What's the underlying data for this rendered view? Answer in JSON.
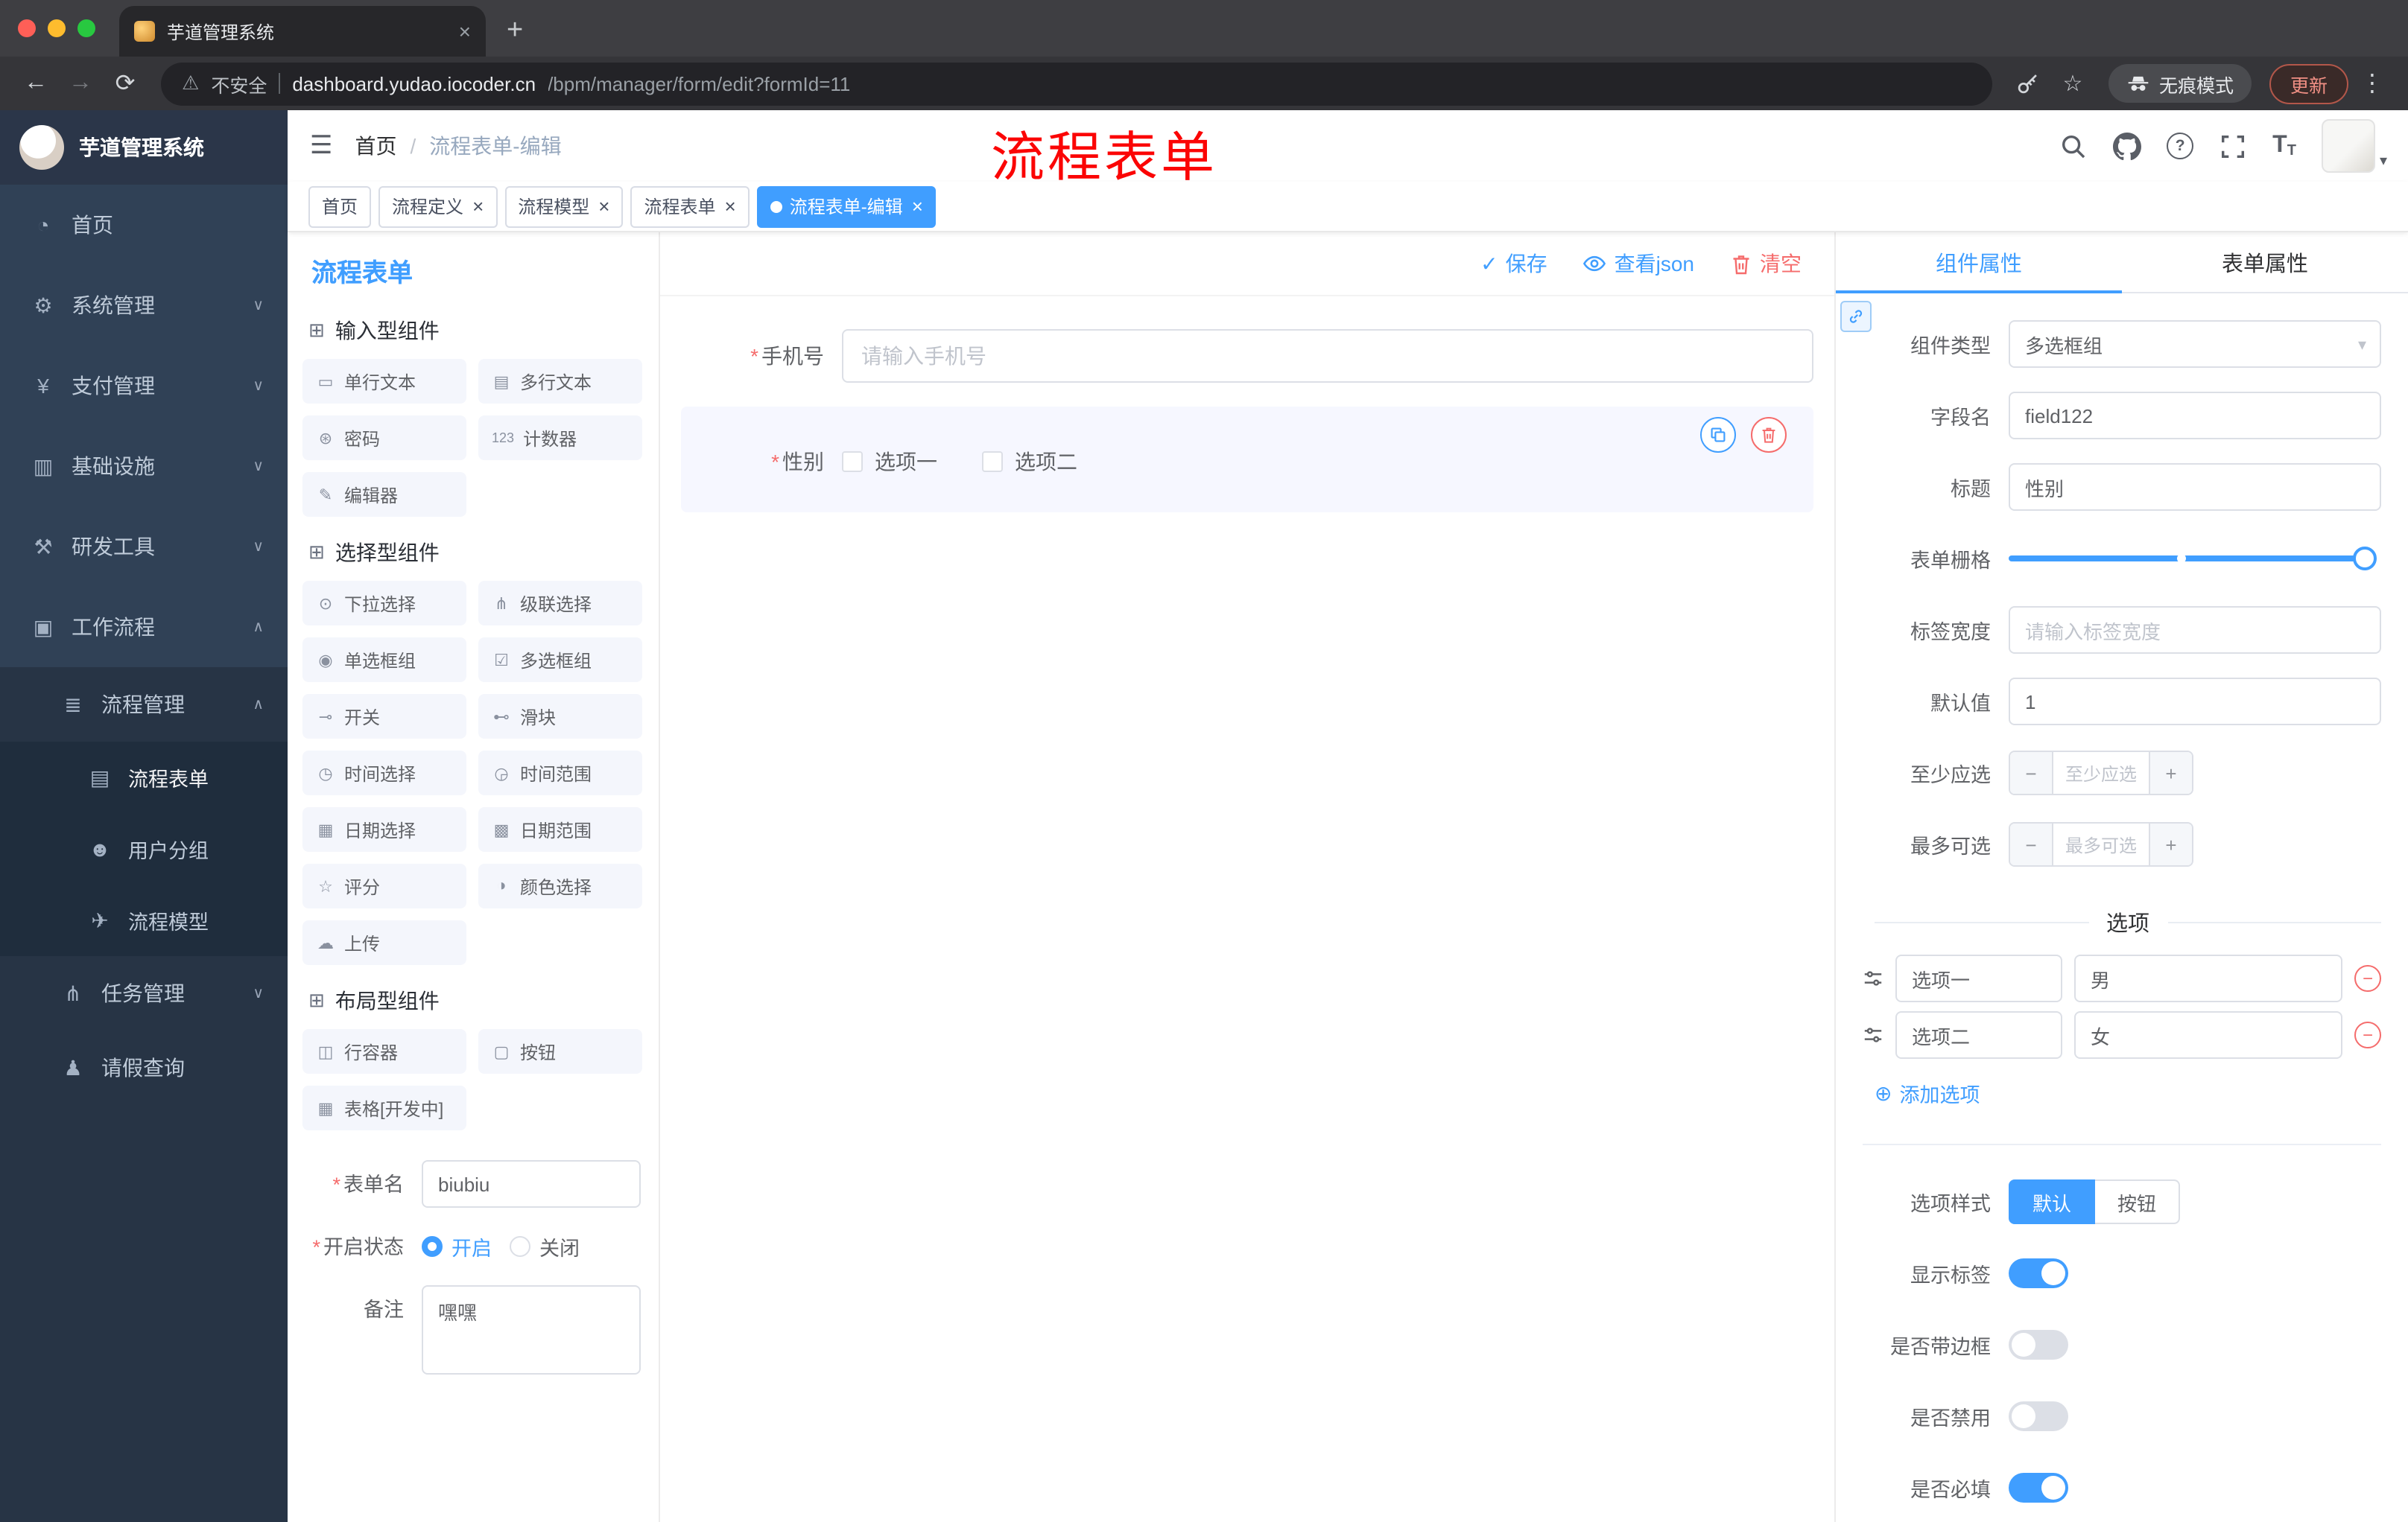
{
  "browser": {
    "tab_title": "芋道管理系统",
    "security_label": "不安全",
    "url_host": "dashboard.yudao.iocoder.cn",
    "url_path": "/bpm/manager/form/edit?formId=11",
    "incognito_label": "无痕模式",
    "update_label": "更新"
  },
  "icons": {
    "close": "×",
    "new_tab": "+",
    "back": "←",
    "forward": "→",
    "reload": "⟳",
    "warning": "⚠",
    "star": "☆",
    "menu_dots": "⋮",
    "hamburger": "☰",
    "slash": "/",
    "caret_down": "▾",
    "check": "✓",
    "add_circle": "⊕",
    "minus_sign": "−",
    "plus_sign": "+",
    "section_cube": "⊞",
    "font_size_big": "T",
    "font_size_small": "T"
  },
  "misc": {
    "required_mark": "*"
  },
  "sidebar": {
    "logo_title": "芋道管理系统",
    "items": [
      {
        "icon": "◔",
        "label": "首页"
      },
      {
        "icon": "⚙",
        "label": "系统管理",
        "chevron": "∨"
      },
      {
        "icon": "¥",
        "label": "支付管理",
        "chevron": "∨"
      },
      {
        "icon": "▥",
        "label": "基础设施",
        "chevron": "∨"
      },
      {
        "icon": "⚒",
        "label": "研发工具",
        "chevron": "∨"
      },
      {
        "icon": "▣",
        "label": "工作流程",
        "chevron": "∧"
      }
    ],
    "sub": [
      {
        "icon": "≣",
        "label": "流程管理",
        "chevron": "∧"
      },
      {
        "icon": "▤",
        "label": "流程表单"
      },
      {
        "icon": "☻",
        "label": "用户分组"
      },
      {
        "icon": "✈",
        "label": "流程模型"
      },
      {
        "icon": "⋔",
        "label": "任务管理",
        "chevron": "∨"
      },
      {
        "icon": "♟",
        "label": "请假查询"
      }
    ]
  },
  "navbar": {
    "breadcrumb_home": "首页",
    "breadcrumb_current": "流程表单-编辑",
    "annotation": "流程表单"
  },
  "tags": [
    {
      "label": "首页"
    },
    {
      "label": "流程定义"
    },
    {
      "label": "流程模型"
    },
    {
      "label": "流程表单"
    },
    {
      "label": "流程表单-编辑"
    }
  ],
  "palette": {
    "title": "流程表单",
    "sections": [
      {
        "title": "输入型组件",
        "items": [
          {
            "icon": "▭",
            "label": "单行文本"
          },
          {
            "icon": "▤",
            "label": "多行文本"
          },
          {
            "icon": "⊛",
            "label": "密码"
          },
          {
            "icon": "123",
            "label": "计数器"
          },
          {
            "icon": "✎",
            "label": "编辑器"
          }
        ]
      },
      {
        "title": "选择型组件",
        "items": [
          {
            "icon": "⊙",
            "label": "下拉选择"
          },
          {
            "icon": "⋔",
            "label": "级联选择"
          },
          {
            "icon": "◉",
            "label": "单选框组"
          },
          {
            "icon": "☑",
            "label": "多选框组"
          },
          {
            "icon": "⊸",
            "label": "开关"
          },
          {
            "icon": "⊷",
            "label": "滑块"
          },
          {
            "icon": "◷",
            "label": "时间选择"
          },
          {
            "icon": "◶",
            "label": "时间范围"
          },
          {
            "icon": "▦",
            "label": "日期选择"
          },
          {
            "icon": "▩",
            "label": "日期范围"
          },
          {
            "icon": "☆",
            "label": "评分"
          },
          {
            "icon": "◑",
            "label": "颜色选择"
          },
          {
            "icon": "☁",
            "label": "上传"
          }
        ]
      },
      {
        "title": "布局型组件",
        "items": [
          {
            "icon": "◫",
            "label": "行容器"
          },
          {
            "icon": "▢",
            "label": "按钮"
          },
          {
            "icon": "▦",
            "label": "表格[开发中]"
          }
        ]
      }
    ],
    "form": {
      "name_label": "表单名",
      "name_value": "biubiu",
      "status_label": "开启状态",
      "status_on": "开启",
      "status_off": "关闭",
      "remark_label": "备注",
      "remark_value": "嘿嘿"
    }
  },
  "canvas": {
    "save": "保存",
    "view_json": "查看json",
    "clear": "清空",
    "phone": {
      "label": "手机号",
      "placeholder": "请输入手机号"
    },
    "gender": {
      "label": "性别",
      "option1": "选项一",
      "option2": "选项二"
    }
  },
  "props": {
    "tab_component": "组件属性",
    "tab_form": "表单属性",
    "component_type_label": "组件类型",
    "component_type_value": "多选框组",
    "field_name_label": "字段名",
    "field_name_value": "field122",
    "title_label": "标题",
    "title_value": "性别",
    "grid_label": "表单栅格",
    "label_width_label": "标签宽度",
    "label_width_placeholder": "请输入标签宽度",
    "default_label": "默认值",
    "default_value": "1",
    "min_label": "至少应选",
    "min_placeholder": "至少应选",
    "max_label": "最多可选",
    "max_placeholder": "最多可选",
    "options_title": "选项",
    "options": [
      {
        "label": "选项一",
        "value": "男"
      },
      {
        "label": "选项二",
        "value": "女"
      }
    ],
    "add_option": "添加选项",
    "option_style_label": "选项样式",
    "style_default": "默认",
    "style_button": "按钮",
    "toggle_show_label": "显示标签",
    "toggle_border": "是否带边框",
    "toggle_disabled": "是否禁用",
    "toggle_required": "是否必填"
  },
  "colors": {
    "accent": "#409eff",
    "danger": "#f56c6c",
    "sidebar_bg": "#304156",
    "annotation_red": "#fb0505"
  }
}
